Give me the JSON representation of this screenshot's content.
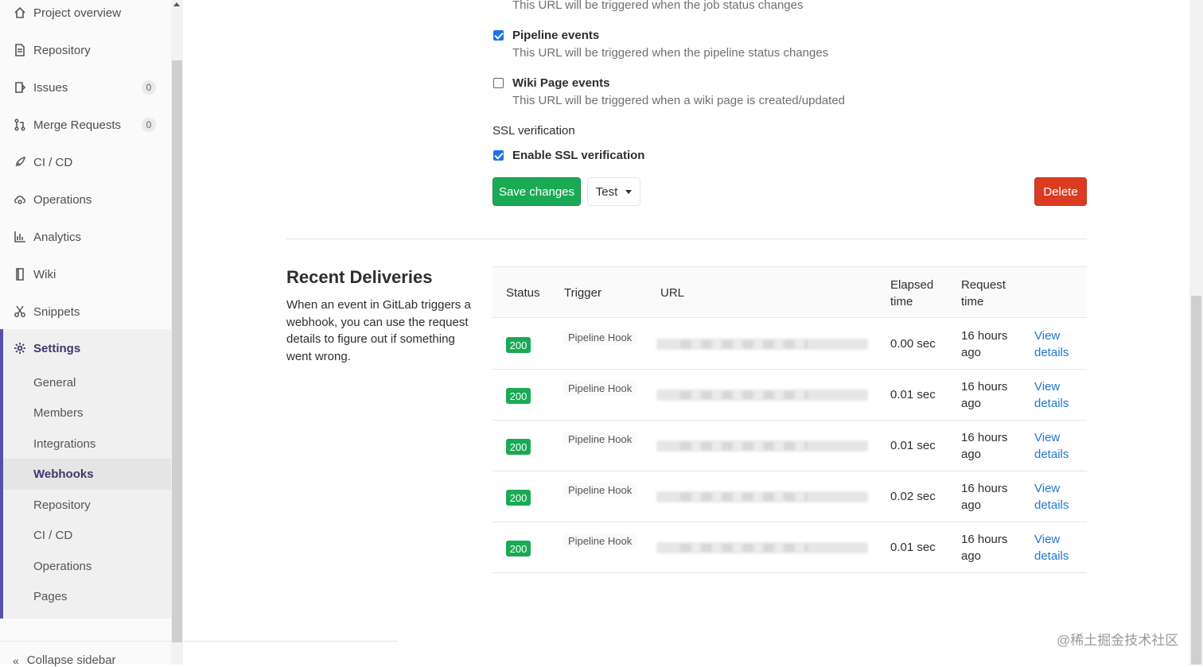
{
  "sidebar": {
    "items": [
      {
        "label": "Project overview",
        "icon": "home-icon"
      },
      {
        "label": "Repository",
        "icon": "doc-icon"
      },
      {
        "label": "Issues",
        "icon": "issues-icon",
        "count": "0"
      },
      {
        "label": "Merge Requests",
        "icon": "merge-icon",
        "count": "0"
      },
      {
        "label": "CI / CD",
        "icon": "rocket-icon"
      },
      {
        "label": "Operations",
        "icon": "cloud-gear-icon"
      },
      {
        "label": "Analytics",
        "icon": "chart-icon"
      },
      {
        "label": "Wiki",
        "icon": "book-icon"
      },
      {
        "label": "Snippets",
        "icon": "scissors-icon"
      },
      {
        "label": "Settings",
        "icon": "gear-icon"
      }
    ],
    "settings_sub": [
      "General",
      "Members",
      "Integrations",
      "Webhooks",
      "Repository",
      "CI / CD",
      "Operations",
      "Pages"
    ],
    "active_sub": "Webhooks",
    "collapse_label": "Collapse sidebar"
  },
  "form": {
    "job_help": "This URL will be triggered when the job status changes",
    "pipeline_label": "Pipeline events",
    "pipeline_checked": true,
    "pipeline_help": "This URL will be triggered when the pipeline status changes",
    "wiki_label": "Wiki Page events",
    "wiki_checked": false,
    "wiki_help": "This URL will be triggered when a wiki page is created/updated",
    "ssl_section": "SSL verification",
    "ssl_label": "Enable SSL verification",
    "ssl_checked": true,
    "save_label": "Save changes",
    "test_label": "Test",
    "delete_label": "Delete"
  },
  "deliveries": {
    "title": "Recent Deliveries",
    "description": "When an event in GitLab triggers a webhook, you can use the request details to figure out if something went wrong.",
    "columns": {
      "status": "Status",
      "trigger": "Trigger",
      "url": "URL",
      "elapsed_1": "Elapsed",
      "elapsed_2": "time",
      "request_1": "Request",
      "request_2": "time"
    },
    "rows": [
      {
        "status": "200",
        "trigger": "Pipeline Hook",
        "elapsed": "0.00 sec",
        "time_1": "16 hours",
        "time_2": "ago",
        "link_1": "View",
        "link_2": "details"
      },
      {
        "status": "200",
        "trigger": "Pipeline Hook",
        "elapsed": "0.01 sec",
        "time_1": "16 hours",
        "time_2": "ago",
        "link_1": "View",
        "link_2": "details"
      },
      {
        "status": "200",
        "trigger": "Pipeline Hook",
        "elapsed": "0.01 sec",
        "time_1": "16 hours",
        "time_2": "ago",
        "link_1": "View",
        "link_2": "details"
      },
      {
        "status": "200",
        "trigger": "Pipeline Hook",
        "elapsed": "0.02 sec",
        "time_1": "16 hours",
        "time_2": "ago",
        "link_1": "View",
        "link_2": "details"
      },
      {
        "status": "200",
        "trigger": "Pipeline Hook",
        "elapsed": "0.01 sec",
        "time_1": "16 hours",
        "time_2": "ago",
        "link_1": "View",
        "link_2": "details"
      }
    ]
  },
  "watermark": "@稀土掘金技术社区",
  "colors": {
    "accent": "#5651a6",
    "success": "#1aaa55",
    "danger": "#db3b21",
    "link": "#1f78d1"
  }
}
